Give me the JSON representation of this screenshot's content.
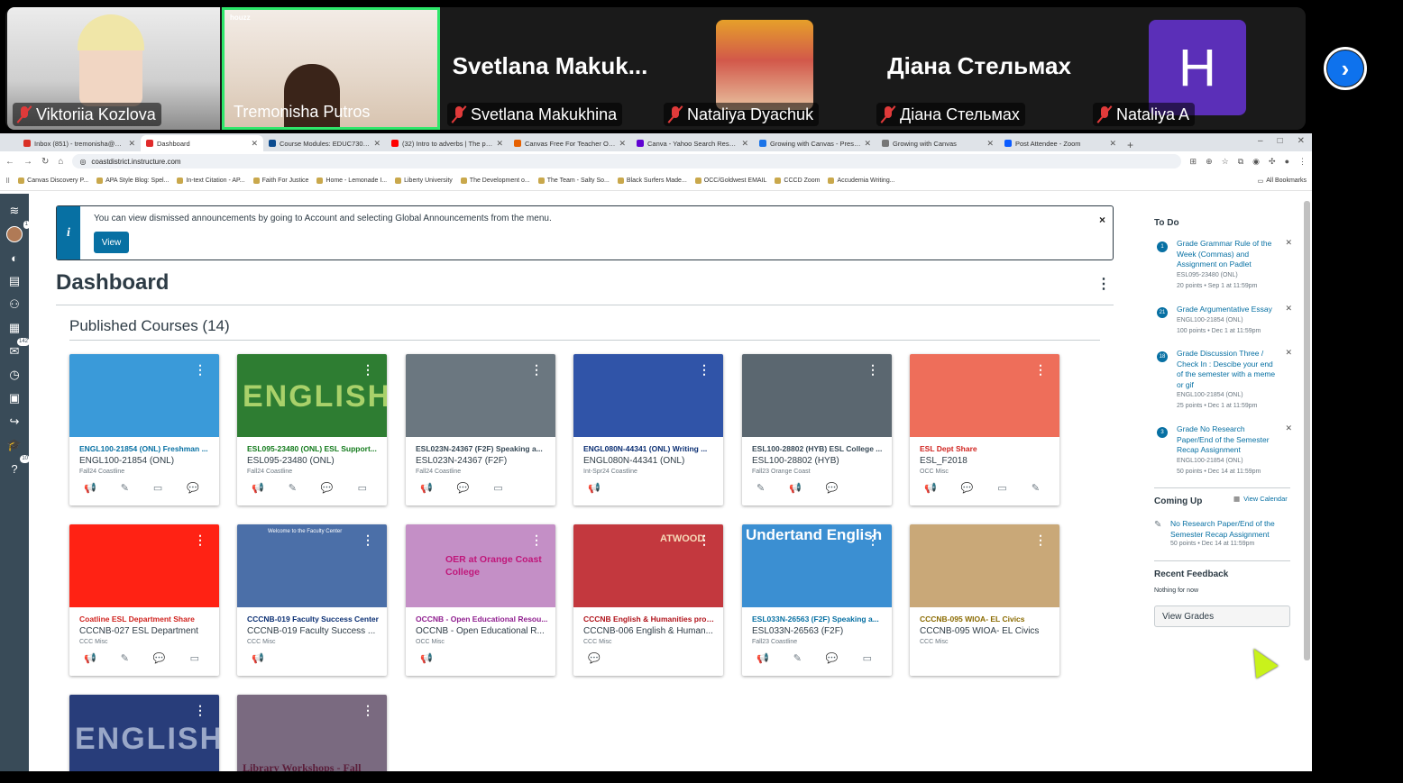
{
  "zoom": {
    "participants": [
      {
        "name": "Viktoriia Kozlova"
      },
      {
        "name": "Tremonisha Putros",
        "watermark": "houzz"
      },
      {
        "name": "Svetlana Makukhina",
        "display": "Svetlana  Makuk..."
      },
      {
        "name": "Nataliya Dyachuk"
      },
      {
        "name": "Діана Стельмах",
        "display": "Діана Стельмах"
      },
      {
        "name": "Nataliya A",
        "initial": "H"
      }
    ],
    "next_icon": "chevron-right-icon"
  },
  "browser": {
    "tabs": [
      {
        "title": "Inbox (851) - tremonisha@gma",
        "color": "#d93025"
      },
      {
        "title": "Dashboard",
        "color": "#e12b2b"
      },
      {
        "title": "Course Modules: EDUC730: Ins",
        "color": "#0b4b8f"
      },
      {
        "title": "(32) Intro to adverbs | The parts",
        "color": "#ff0000"
      },
      {
        "title": "Canvas Free For Teacher Orient",
        "color": "#e66000"
      },
      {
        "title": "Canva - Yahoo Search Results",
        "color": "#6001d2"
      },
      {
        "title": "Growing with Canvas - Presente",
        "color": "#1a73e8"
      },
      {
        "title": "Growing with Canvas",
        "color": "#777777"
      },
      {
        "title": "Post Attendee - Zoom",
        "color": "#0b5cff"
      }
    ],
    "url": "coastdistrict.instructure.com",
    "bookmarks": [
      "Canvas Discovery P...",
      "APA Style Blog: Spel...",
      "In-text Citation - AP...",
      "Faith For Justice",
      "Home - Lemonade I...",
      "Liberty University",
      "The Development o...",
      "The Team - Salty So...",
      "Black Surfers Made...",
      "OCC/Goldwest EMAIL",
      "CCCD Zoom",
      "Accudemia Writing..."
    ],
    "all_bookmarks": "All Bookmarks"
  },
  "nav": {
    "inbox_badge": "1",
    "history_badge": "142",
    "help_badge": "10"
  },
  "announcement": {
    "text": "You can view dismissed announcements by going to Account and selecting Global Announcements from the menu.",
    "button": "View",
    "close": "×"
  },
  "dashboard": {
    "title": "Dashboard",
    "section": "Published Courses (14)"
  },
  "courses": [
    {
      "code": "ENGL100-21854 (ONL) Freshman ...",
      "name": "ENGL100-21854 (ONL)",
      "term": "Fall24 Coastline",
      "color": "#0770a3",
      "hero": "#3a9ad9",
      "overlay": ""
    },
    {
      "code": "ESL095-23480 (ONL) ESL Support...",
      "name": "ESL095-23480 (ONL)",
      "term": "Fall24 Coastline",
      "color": "#127a1b",
      "hero": "#2e7d32",
      "overlay": "ENGLISH"
    },
    {
      "code": "ESL023N-24367 (F2F) Speaking a...",
      "name": "ESL023N-24367 (F2F)",
      "term": "Fall24 Coastline",
      "color": "#394b58",
      "hero": "#6b7780",
      "overlay": ""
    },
    {
      "code": "ENGL080N-44341 (ONL) Writing ...",
      "name": "ENGL080N-44341 (ONL)",
      "term": "Int-Spr24 Coastline",
      "color": "#0b2f73",
      "hero": "#3054a8",
      "overlay": ""
    },
    {
      "code": "ESL100-28802 (HYB) ESL College ...",
      "name": "ESL100-28802 (HYB)",
      "term": "Fall23 Orange Coast",
      "color": "#394b58",
      "hero": "#5b6770",
      "overlay": ""
    },
    {
      "code": "ESL Dept Share",
      "name": "ESL_F2018",
      "term": "OCC Misc",
      "color": "#d0231f",
      "hero": "#ee6e5a",
      "overlay": ""
    },
    {
      "code": "Coatline ESL Department Share",
      "name": "CCCNB-027 ESL Department",
      "term": "CCC Misc",
      "color": "#d0231f",
      "hero": "#ff2214",
      "overlay": ""
    },
    {
      "code": "CCCNB-019 Faculty Success Center",
      "name": "CCCNB-019 Faculty Success ...",
      "term": "CCC Misc",
      "color": "#0b2f73",
      "hero": "#4b6fa8",
      "overlay": "Welcome to the Faculty Center"
    },
    {
      "code": "OCCNB - Open Educational Resou...",
      "name": "OCCNB - Open Educational R...",
      "term": "OCC Misc",
      "color": "#8f1e8f",
      "hero": "#c48fc6",
      "overlay": "OER at Orange Coast College"
    },
    {
      "code": "CCCNB English & Humanities prog...",
      "name": "CCCNB-006 English & Human...",
      "term": "CCC Misc",
      "color": "#b0121a",
      "hero": "#c3383e",
      "overlay": "ATWOOD"
    },
    {
      "code": "ESL033N-26563 (F2F) Speaking a...",
      "name": "ESL033N-26563 (F2F)",
      "term": "Fall23 Coastline",
      "color": "#0770a3",
      "hero": "#3b8fd2",
      "overlay": "Undertand English"
    },
    {
      "code": "CCCNB-095 WIOA- EL Civics",
      "name": "CCCNB-095 WIOA- EL Civics",
      "term": "CCC Misc",
      "color": "#8a6a00",
      "hero": "#c9a878",
      "overlay": ""
    },
    {
      "code": "",
      "name": "",
      "term": "",
      "color": "#0b2f73",
      "hero": "#283d7a",
      "overlay": "ENGLISH"
    },
    {
      "code": "",
      "name": "",
      "term": "",
      "color": "#5a3a6b",
      "hero": "#7a6a80",
      "overlay": "Library Workshops - Fall"
    }
  ],
  "sidebar": {
    "todo_title": "To Do",
    "todos": [
      {
        "num": "1",
        "title": "Grade Grammar Rule of the Week (Commas) and Assignment on Padlet",
        "course": "ESL095-23480 (ONL)",
        "meta": "20 points • Sep 1 at 11:59pm"
      },
      {
        "num": "21",
        "title": "Grade Argumentative Essay",
        "course": "ENGL100-21854 (ONL)",
        "meta": "100 points • Dec 1 at 11:59pm"
      },
      {
        "num": "18",
        "title": "Grade Discussion Three / Check In : Descibe your end of the semester with a meme or gif",
        "course": "ENGL100-21854 (ONL)",
        "meta": "25 points • Dec 1 at 11:59pm"
      },
      {
        "num": "3",
        "title": "Grade No Research Paper/End of the Semester Recap Assignment",
        "course": "ENGL100-21854 (ONL)",
        "meta": "50 points • Dec 14 at 11:59pm"
      }
    ],
    "coming_up": "Coming Up",
    "view_calendar": "View Calendar",
    "upcoming": {
      "title": "No Research Paper/End of the Semester Recap Assignment",
      "meta": "50 points • Dec 14 at 11:59pm"
    },
    "recent_feedback": "Recent Feedback",
    "nothing": "Nothing for now",
    "view_grades": "View Grades"
  }
}
